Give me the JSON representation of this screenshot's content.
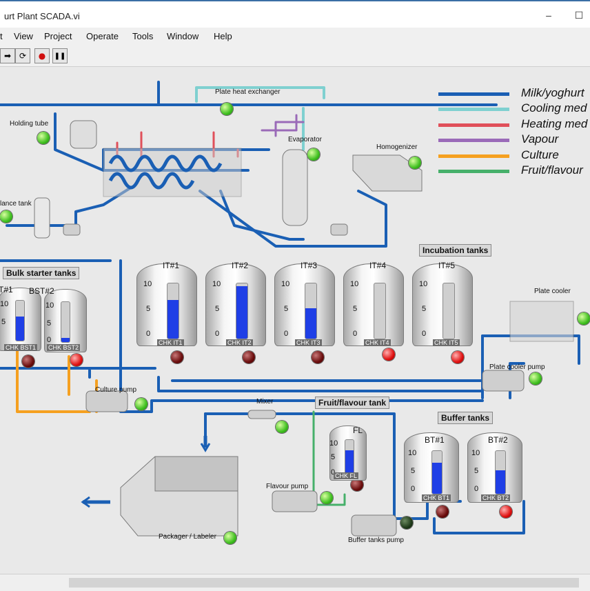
{
  "window": {
    "title": "urt Plant SCADA.vi",
    "minimize": "–",
    "maximize": "☐"
  },
  "menu": [
    "t",
    "View",
    "Project",
    "Operate",
    "Tools",
    "Window",
    "Help"
  ],
  "toolbar": {
    "run": "➡",
    "run_continuous": "⟳",
    "abort": "●",
    "pause": "❚❚"
  },
  "legend": [
    {
      "label": "Milk/yoghurt",
      "color": "#1a5fb4"
    },
    {
      "label": "Cooling med",
      "color": "#7fd0d0"
    },
    {
      "label": "Heating med",
      "color": "#e0505a"
    },
    {
      "label": "Vapour",
      "color": "#9a6ab8"
    },
    {
      "label": "Culture",
      "color": "#f5a020"
    },
    {
      "label": "Fruit/flavour",
      "color": "#46b06a"
    }
  ],
  "labels": {
    "plate_heat_exchanger": "Plate heat exchanger",
    "holding_tube": "Holding tube",
    "evaporator": "Evaporator",
    "homogenizer": "Homogenizer",
    "balance_tank": "lance tank",
    "incubation_tanks": "Incubation tanks",
    "bulk_starter_tanks": "Bulk starter tanks",
    "plate_cooler": "Plate cooler",
    "plate_cooler_pump": "Plate cooler pump",
    "culture_pump": "Culture pump",
    "mixer": "Mixer",
    "fruit_flavour_tank": "Fruit/flavour tank",
    "buffer_tanks": "Buffer tanks",
    "flavour_pump": "Flavour pump",
    "buffer_tanks_pump": "Buffer tanks pump",
    "packager_labeler": "Packager / Labeler"
  },
  "scale": {
    "top": "10",
    "mid": "5",
    "bottom": "0"
  },
  "tanks": [
    {
      "name": "IT#1",
      "chk": "CHK IT1",
      "level": 0.7
    },
    {
      "name": "IT#2",
      "chk": "CHK IT2",
      "level": 0.95
    },
    {
      "name": "IT#3",
      "chk": "CHK IT3",
      "level": 0.55
    },
    {
      "name": "IT#4",
      "chk": "CHK IT4",
      "level": 0.0
    },
    {
      "name": "IT#5",
      "chk": "CHK IT5",
      "level": 0.0
    },
    {
      "name": "T#1",
      "chk": "CHK BST1",
      "level": 0.6
    },
    {
      "name": "BST#2",
      "chk": "CHK BST2",
      "level": 0.1
    },
    {
      "name": "FL",
      "chk": "CHK FL",
      "level": 0.7
    },
    {
      "name": "BT#1",
      "chk": "CHK BT1",
      "level": 0.72
    },
    {
      "name": "BT#2",
      "chk": "CHK BT2",
      "level": 0.55
    }
  ],
  "status_colors": {
    "running": "#3fbf1f",
    "alarm": "#e01010",
    "idle": "#6a0c0c"
  }
}
